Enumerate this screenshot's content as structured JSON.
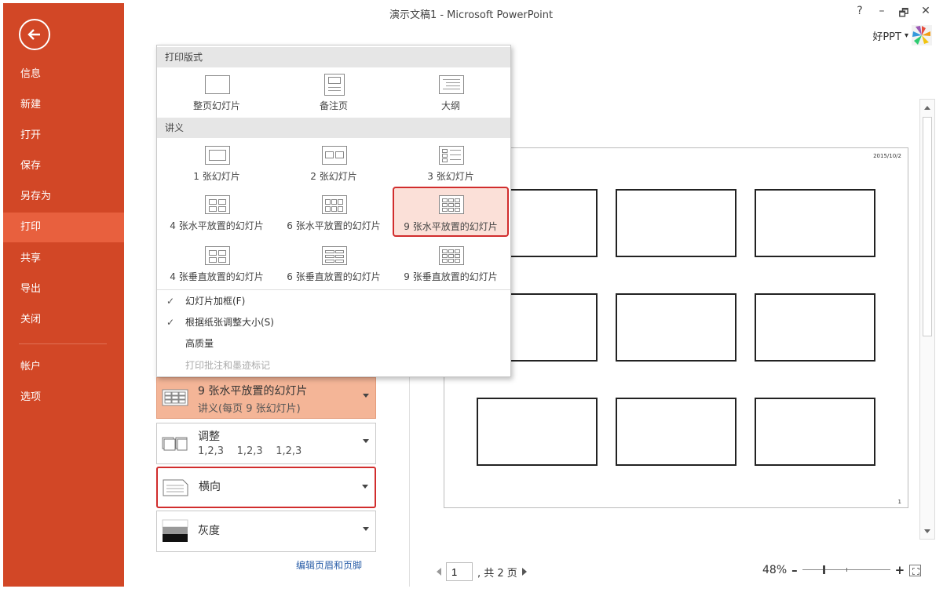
{
  "window": {
    "title": "演示文稿1 - Microsoft PowerPoint",
    "help": "?",
    "minimize": "–",
    "restore": "🗗",
    "close": "✕",
    "user": "好PPT",
    "user_dropdown": "▾"
  },
  "sidebar": {
    "items": [
      {
        "label": "信息",
        "active": false
      },
      {
        "label": "新建",
        "active": false
      },
      {
        "label": "打开",
        "active": false
      },
      {
        "label": "保存",
        "active": false
      },
      {
        "label": "另存为",
        "active": false
      },
      {
        "label": "打印",
        "active": true
      },
      {
        "label": "共享",
        "active": false
      },
      {
        "label": "导出",
        "active": false
      },
      {
        "label": "关闭",
        "active": false
      },
      {
        "label": "帐户",
        "active": false
      },
      {
        "label": "选项",
        "active": false
      }
    ]
  },
  "popup": {
    "layout_header": "打印版式",
    "layouts": [
      "整页幻灯片",
      "备注页",
      "大纲"
    ],
    "handouts_header": "讲义",
    "handouts": [
      "1 张幻灯片",
      "2 张幻灯片",
      "3 张幻灯片",
      "4 张水平放置的幻灯片",
      "6 张水平放置的幻灯片",
      "9 张水平放置的幻灯片",
      "4 张垂直放置的幻灯片",
      "6 张垂直放置的幻灯片",
      "9 张垂直放置的幻灯片"
    ],
    "selected_handout": "9 张水平放置的幻灯片",
    "options": [
      {
        "label": "幻灯片加框(F)",
        "checked": true,
        "enabled": true
      },
      {
        "label": "根据纸张调整大小(S)",
        "checked": true,
        "enabled": true
      },
      {
        "label": "高质量",
        "checked": false,
        "enabled": true
      },
      {
        "label": "打印批注和墨迹标记",
        "checked": false,
        "enabled": false
      }
    ],
    "check_glyph": "✓"
  },
  "settings": {
    "layout": {
      "title": "9 张水平放置的幻灯片",
      "subtitle": "讲义(每页 9 张幻灯片)"
    },
    "collate": {
      "title": "调整",
      "subtitle": "1,2,3    1,2,3    1,2,3"
    },
    "orientation": {
      "title": "横向"
    },
    "color": {
      "title": "灰度"
    },
    "header_footer_link": "编辑页眉和页脚"
  },
  "preview": {
    "date": "2015/10/2",
    "page_number": "1",
    "current_page": "1",
    "total_pages_text": ", 共 2 页",
    "zoom": "48%",
    "zoom_minus": "–",
    "zoom_plus": "+"
  },
  "colors": {
    "accent": "#d24726",
    "highlight": "#f4b597",
    "selection_border": "#d12d2d"
  }
}
